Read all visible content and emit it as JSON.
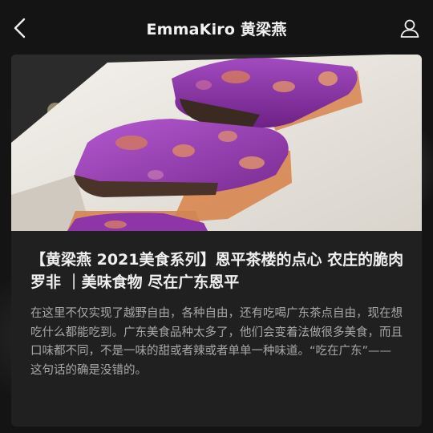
{
  "header": {
    "title": "EmmaKiro 黄梁燕",
    "back_icon": "chevron-left-icon",
    "profile_icon": "user-profile-icon"
  },
  "article": {
    "title": "【黄梁燕 2021美食系列】恩平茶楼的点心 农庄的脆肉罗非 ｜美味食物 尽在广东恩平",
    "summary": "在这里不仅实现了越野自由，各种自由，还有吃喝广东茶点自由，现在想吃什么都能吃到。广东美食品种太多了，他们会变着法做很多美食，而且口味都不同，不是一味的甜或者辣或者单单一种味道。“吃在广东”——这句话的确是没错的。"
  },
  "colors": {
    "background": "#151515",
    "card": "#202020",
    "title_text": "#f0f0f0",
    "summary_text": "#a8a8a8",
    "purple_food": "#8a2fa0"
  }
}
